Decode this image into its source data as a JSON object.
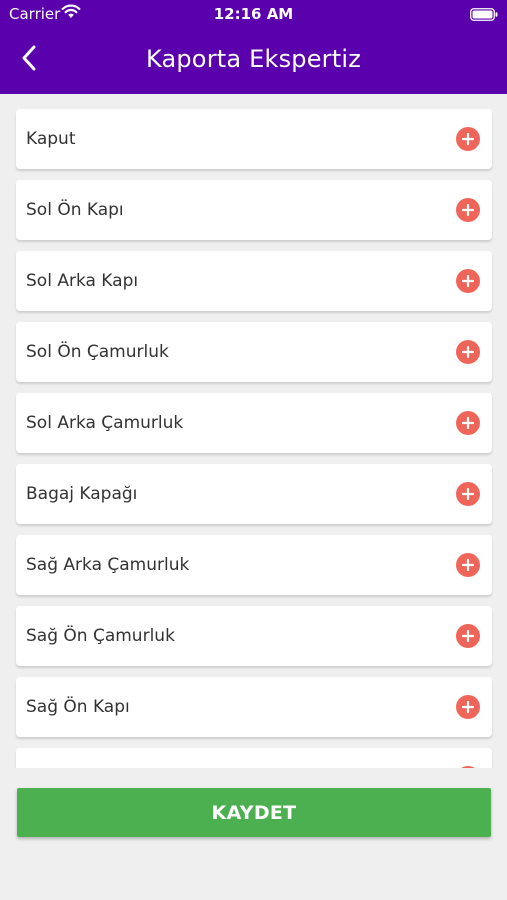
{
  "status_bar": {
    "carrier": "Carrier",
    "time": "12:16 AM",
    "wifi_icon": "wifi-icon",
    "battery_icon": "battery-icon"
  },
  "header": {
    "title": "Kaporta Ekspertiz",
    "back_icon": "chevron-left-icon",
    "background": "#5a00ad"
  },
  "parts": [
    {
      "label": "Kaput"
    },
    {
      "label": "Sol Ön Kapı"
    },
    {
      "label": "Sol Arka Kapı"
    },
    {
      "label": "Sol Ön Çamurluk"
    },
    {
      "label": "Sol Arka Çamurluk"
    },
    {
      "label": "Bagaj Kapağı"
    },
    {
      "label": "Sağ Arka Çamurluk"
    },
    {
      "label": "Sağ Ön Çamurluk"
    },
    {
      "label": "Sağ Ön Kapı"
    },
    {
      "label": ""
    }
  ],
  "item_icon": "plus-circle-icon",
  "colors": {
    "add_icon": "#ef6559",
    "save_button": "#4caf50",
    "page_background": "#efefef"
  },
  "save_button": {
    "label": "KAYDET"
  }
}
